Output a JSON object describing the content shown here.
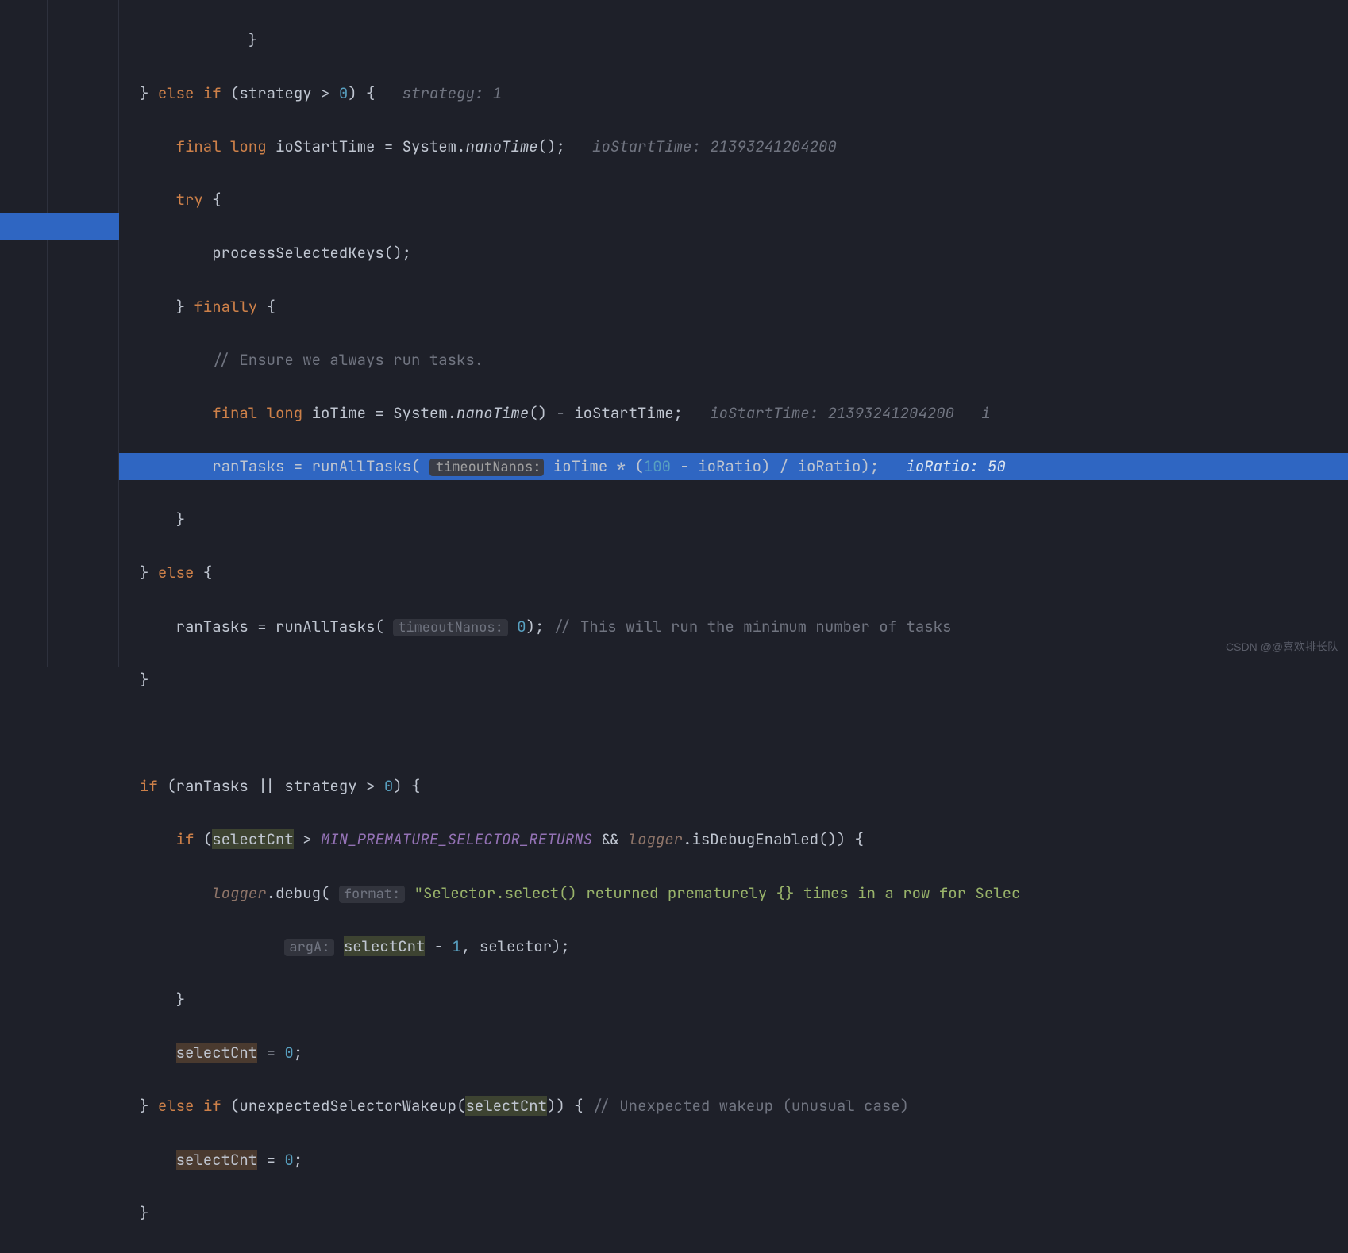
{
  "watermark": "CSDN @@喜欢排长队",
  "hints": {
    "strategy": "strategy: 1",
    "ioStartTime": "ioStartTime: 21393241204200",
    "ioStartTime2": "ioStartTime: 21393241204200",
    "ioRatio": "ioRatio: 50",
    "timeoutNanos": "timeoutNanos:",
    "timeoutNanos2": "timeoutNanos:",
    "format": "format:",
    "argA": "argA:"
  },
  "code": {
    "l1": "            }",
    "l2a": "} ",
    "l2b": "else if",
    "l2c": " (strategy > ",
    "l2d": "0",
    "l2e": ") {   ",
    "l3a": "    ",
    "l3b": "final long",
    "l3c": " ioStartTime = System.",
    "l3d": "nanoTime",
    "l3e": "();   ",
    "l4a": "    ",
    "l4b": "try",
    "l4c": " {",
    "l5": "        processSelectedKeys();",
    "l6a": "    } ",
    "l6b": "finally",
    "l6c": " {",
    "l7": "        // Ensure we always run tasks.",
    "l8a": "        ",
    "l8b": "final long",
    "l8c": " ioTime = System.",
    "l8d": "nanoTime",
    "l8e": "() - ioStartTime;   ",
    "l8f": "i",
    "l9a": "        ranTasks = runAllTasks( ",
    "l9b": " ioTime * (",
    "l9c": "100",
    "l9d": " - ioRatio) / ioRatio);   ",
    "l10": "    }",
    "l11a": "} ",
    "l11b": "else",
    "l11c": " {",
    "l12a": "    ranTasks = runAllTasks( ",
    "l12b": " ",
    "l12c": "0",
    "l12d": "); ",
    "l12e": "// This will run the minimum number of tasks",
    "l13": "}",
    "l15a": "if",
    "l15b": " (ranTasks || strategy > ",
    "l15c": "0",
    "l15d": ") {",
    "l16a": "    ",
    "l16b": "if",
    "l16c": " (",
    "l16d": "selectCnt",
    "l16e": " > ",
    "l16f": "MIN_PREMATURE_SELECTOR_RETURNS",
    "l16g": " && ",
    "l16h": "logger",
    "l16i": ".isDebugEnabled()) {",
    "l17a": "        ",
    "l17b": "logger",
    "l17c": ".debug( ",
    "l17d": " ",
    "l17e": "\"Selector.select() returned prematurely {} times in a row for Selec",
    "l18a": "                ",
    "l18b": " ",
    "l18c": "selectCnt",
    "l18d": " - ",
    "l18e": "1",
    "l18f": ", selector);",
    "l19": "    }",
    "l20a": "    ",
    "l20b": "selectCnt",
    "l20c": " = ",
    "l20d": "0",
    "l20e": ";",
    "l21a": "} ",
    "l21b": "else if",
    "l21c": " (unexpectedSelectorWakeup(",
    "l21d": "selectCnt",
    "l21e": ")) { ",
    "l21f": "// Unexpected wakeup (unusual case)",
    "l22a": "    ",
    "l22b": "selectCnt",
    "l22c": " = ",
    "l22d": "0",
    "l22e": ";",
    "l23": "}"
  }
}
